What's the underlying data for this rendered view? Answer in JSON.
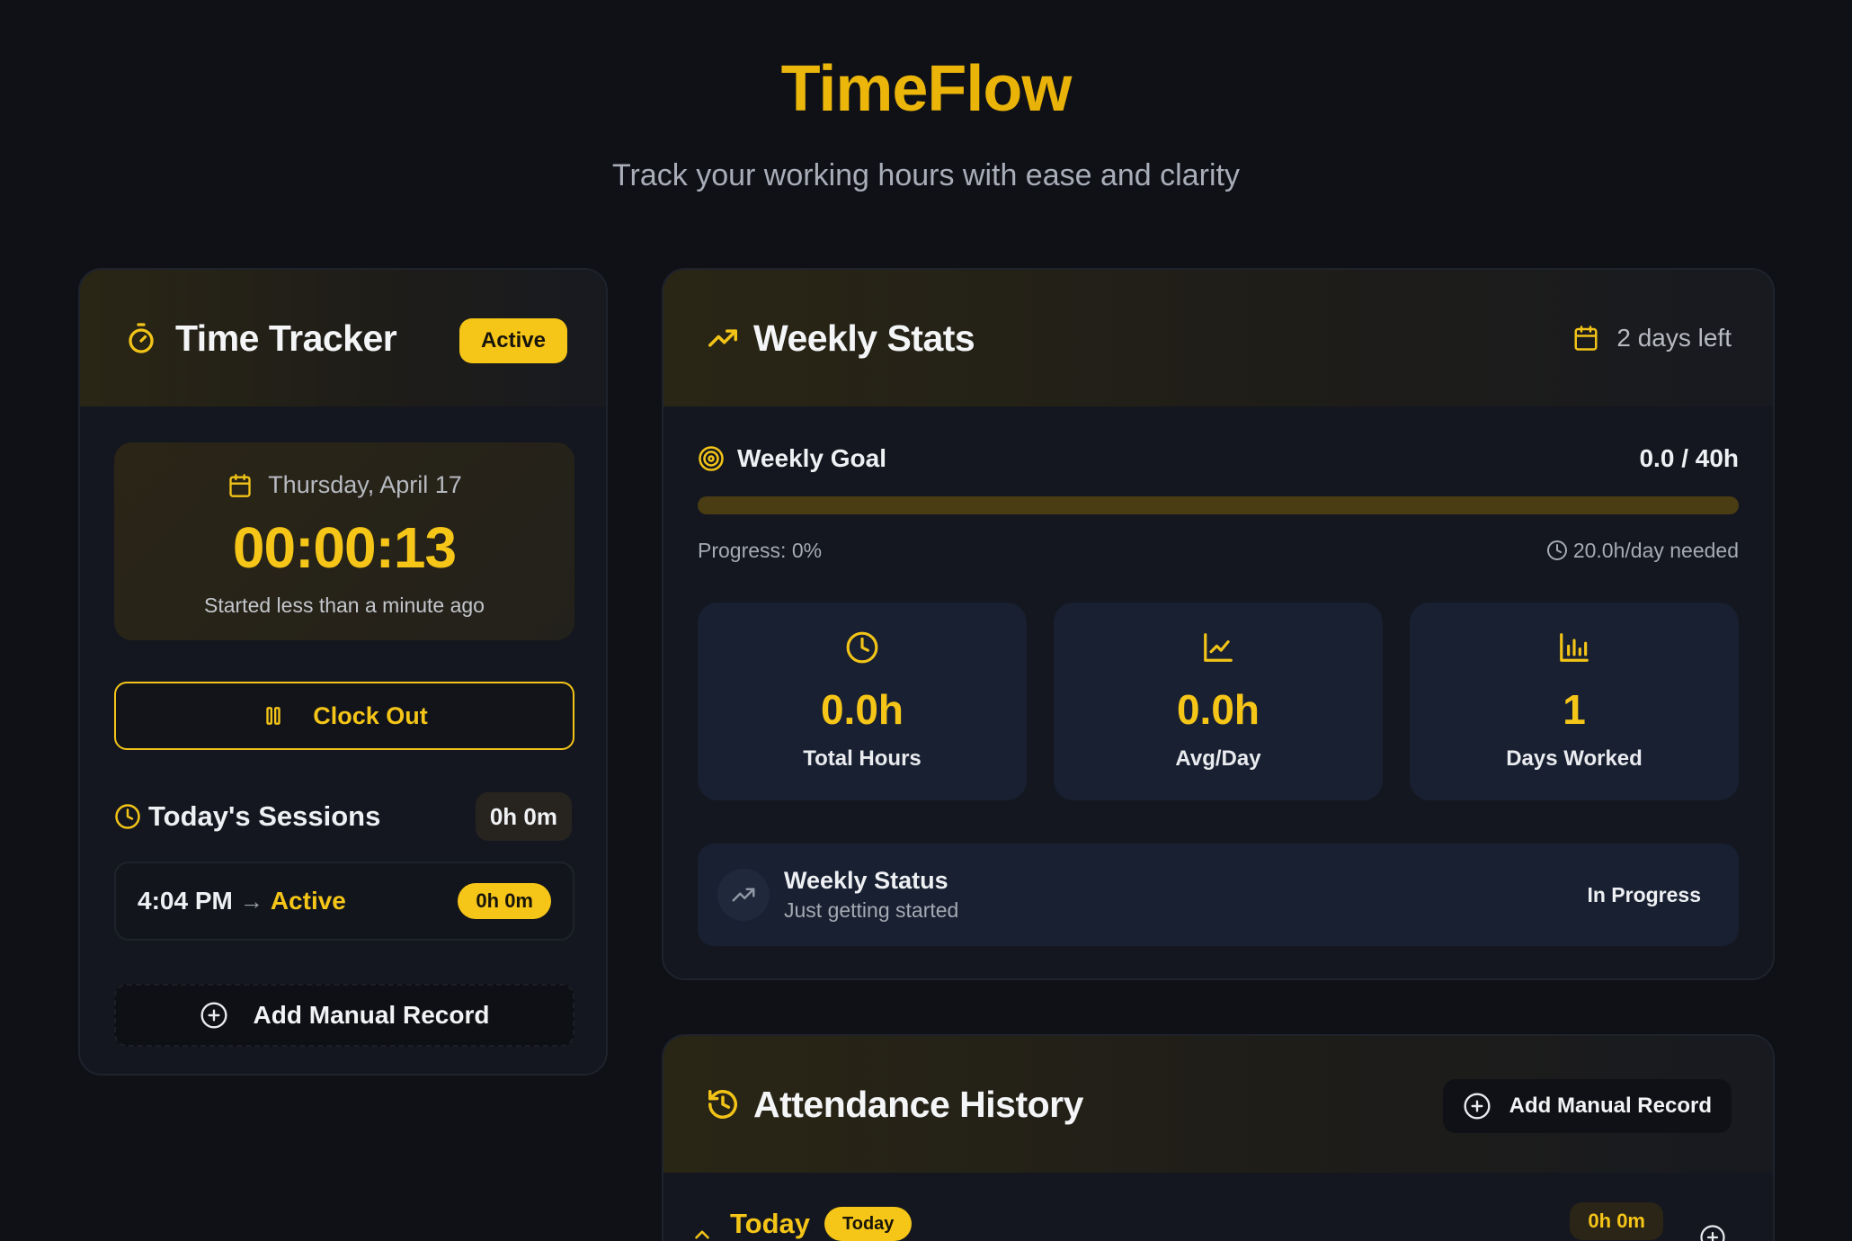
{
  "header": {
    "title": "TimeFlow",
    "tagline": "Track your working hours with ease and clarity"
  },
  "tracker": {
    "title": "Time Tracker",
    "status_badge": "Active",
    "date": "Thursday, April 17",
    "elapsed": "00:00:13",
    "started_text": "Started less than a minute ago",
    "clock_out_label": "Clock Out",
    "sessions_title": "Today's Sessions",
    "sessions_total": "0h 0m",
    "sessions": [
      {
        "start": "4:04 PM",
        "arrow": "→",
        "state": "Active",
        "duration": "0h 0m"
      }
    ],
    "add_manual_label": "Add Manual Record"
  },
  "weekly": {
    "title": "Weekly Stats",
    "days_left": "2 days left",
    "goal_label": "Weekly Goal",
    "goal_value": "0.0 / 40h",
    "progress_percent": 0,
    "progress_text": "Progress: 0%",
    "needed_text": "20.0h/day needed",
    "stats": [
      {
        "icon": "clock-icon",
        "value": "0.0h",
        "label": "Total Hours"
      },
      {
        "icon": "line-chart-icon",
        "value": "0.0h",
        "label": "Avg/Day"
      },
      {
        "icon": "bar-chart-icon",
        "value": "1",
        "label": "Days Worked"
      }
    ],
    "status_title": "Weekly Status",
    "status_sub": "Just getting started",
    "status_badge": "In Progress"
  },
  "attendance": {
    "title": "Attendance History",
    "add_manual_label": "Add Manual Record",
    "group_label": "Today",
    "group_badge": "Today",
    "group_total": "0h 0m"
  },
  "colors": {
    "accent": "#f5c518",
    "background": "#0f1117",
    "card": "#14171f",
    "stat_tile": "#182031"
  }
}
